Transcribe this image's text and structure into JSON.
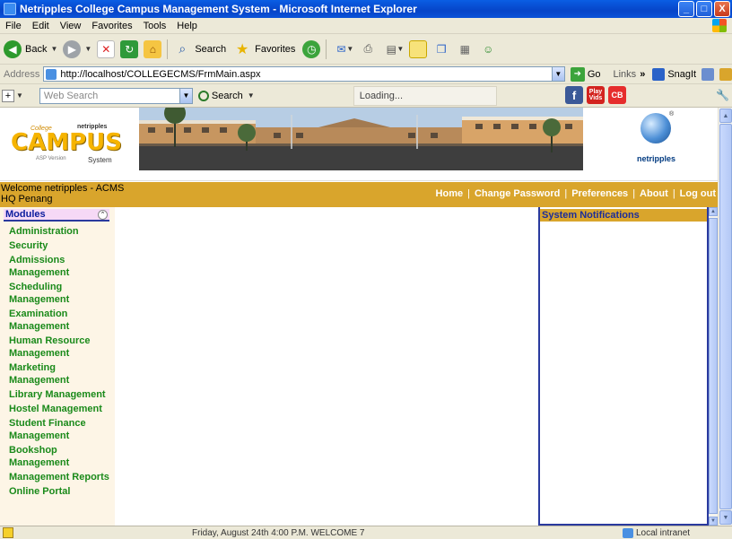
{
  "window": {
    "title": "Netripples College Campus Management System - Microsoft Internet Explorer",
    "minimize": "_",
    "maximize": "□",
    "close": "X"
  },
  "menu": [
    "File",
    "Edit",
    "View",
    "Favorites",
    "Tools",
    "Help"
  ],
  "toolbar": {
    "back": "Back",
    "search": "Search",
    "favorites": "Favorites"
  },
  "address": {
    "label": "Address",
    "url": "http://localhost/COLLEGECMS/FrmMain.aspx",
    "go": "Go",
    "links": "Links",
    "links_chevron": "»",
    "snagit": "SnagIt"
  },
  "searchbar": {
    "placeholder": "Web Search",
    "search_label": "Search",
    "loading": "Loading..."
  },
  "header": {
    "logo_college": "College",
    "logo_brand": "netripples",
    "logo_campus": "CAMPUS",
    "logo_system": "System",
    "logo_version": "ASP Version",
    "brand_name": "netripples",
    "reg_mark": "®"
  },
  "nav": {
    "welcome": "Welcome netripples - ACMS HQ Penang",
    "links": [
      "Home",
      "Change Password",
      "Preferences",
      "About",
      "Log out"
    ],
    "separator": "|"
  },
  "modules": {
    "title": "Modules",
    "collapse_glyph": "⌃",
    "items": [
      "Administration",
      "Security",
      "Admissions\nManagement",
      "Scheduling\nManagement",
      "Examination\nManagement",
      "Human Resource\nManagement",
      "Marketing\nManagement",
      "Library Management",
      "Hostel Management",
      "Student Finance\nManagement",
      "Bookshop\nManagement",
      "Management Reports",
      "Online Portal"
    ]
  },
  "notifications": {
    "title": "System Notifications"
  },
  "status": {
    "text": "Friday, August 24th   4:00 P.M.   WELCOME 7",
    "zone": "Local intranet"
  }
}
